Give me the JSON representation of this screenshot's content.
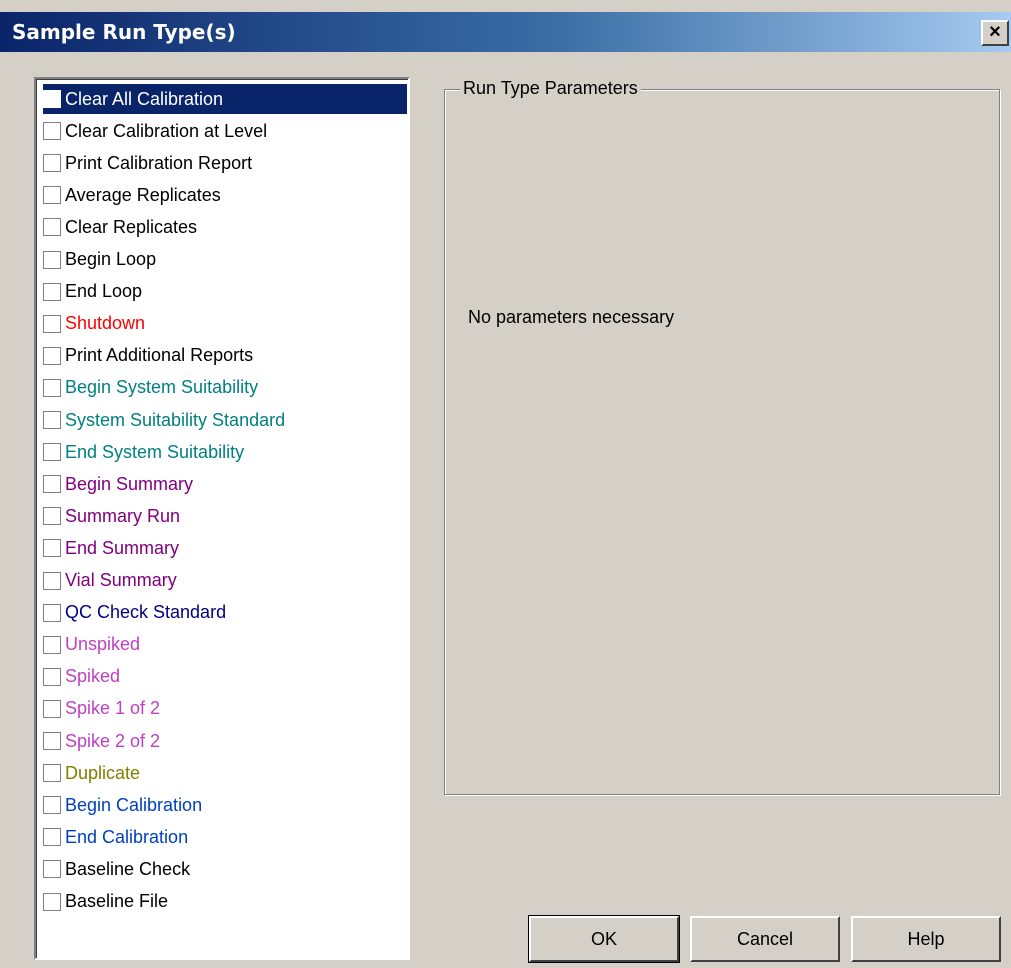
{
  "window": {
    "title": "Sample Run Type(s)",
    "close_label": "×"
  },
  "run_types": [
    {
      "label": "Clear All Calibration",
      "color": "#ffffff",
      "selected": true,
      "checked": false
    },
    {
      "label": "Clear Calibration at Level",
      "color": "#000000",
      "checked": false
    },
    {
      "label": "Print Calibration Report",
      "color": "#000000",
      "checked": false
    },
    {
      "label": "Average Replicates",
      "color": "#000000",
      "checked": false
    },
    {
      "label": "Clear Replicates",
      "color": "#000000",
      "checked": false
    },
    {
      "label": "Begin Loop",
      "color": "#000000",
      "checked": false
    },
    {
      "label": "End Loop",
      "color": "#000000",
      "checked": false
    },
    {
      "label": "Shutdown",
      "color": "#ff0000",
      "checked": false
    },
    {
      "label": "Print Additional Reports",
      "color": "#000000",
      "checked": false
    },
    {
      "label": "Begin System Suitability",
      "color": "#008080",
      "checked": false
    },
    {
      "label": "System Suitability Standard",
      "color": "#008080",
      "checked": false
    },
    {
      "label": "End System Suitability",
      "color": "#008080",
      "checked": false
    },
    {
      "label": "Begin Summary",
      "color": "#800080",
      "checked": false
    },
    {
      "label": "Summary Run",
      "color": "#800080",
      "checked": false
    },
    {
      "label": "End Summary",
      "color": "#800080",
      "checked": false
    },
    {
      "label": "Vial Summary",
      "color": "#800080",
      "checked": false
    },
    {
      "label": "QC Check Standard",
      "color": "#000080",
      "checked": false
    },
    {
      "label": "Unspiked",
      "color": "#c040c0",
      "checked": false
    },
    {
      "label": "Spiked",
      "color": "#c040c0",
      "checked": false
    },
    {
      "label": "Spike 1 of 2",
      "color": "#c040c0",
      "checked": false
    },
    {
      "label": "Spike 2 of 2",
      "color": "#c040c0",
      "checked": false
    },
    {
      "label": "Duplicate",
      "color": "#808000",
      "checked": false
    },
    {
      "label": "Begin Calibration",
      "color": "#0040c0",
      "checked": false
    },
    {
      "label": "End Calibration",
      "color": "#0040c0",
      "checked": false
    },
    {
      "label": "Baseline Check",
      "color": "#000000",
      "checked": false
    },
    {
      "label": "Baseline File",
      "color": "#000000",
      "checked": false
    }
  ],
  "parameters": {
    "group_label": "Run Type Parameters",
    "message": "No parameters necessary"
  },
  "buttons": {
    "ok": "OK",
    "cancel": "Cancel",
    "help": "Help"
  }
}
